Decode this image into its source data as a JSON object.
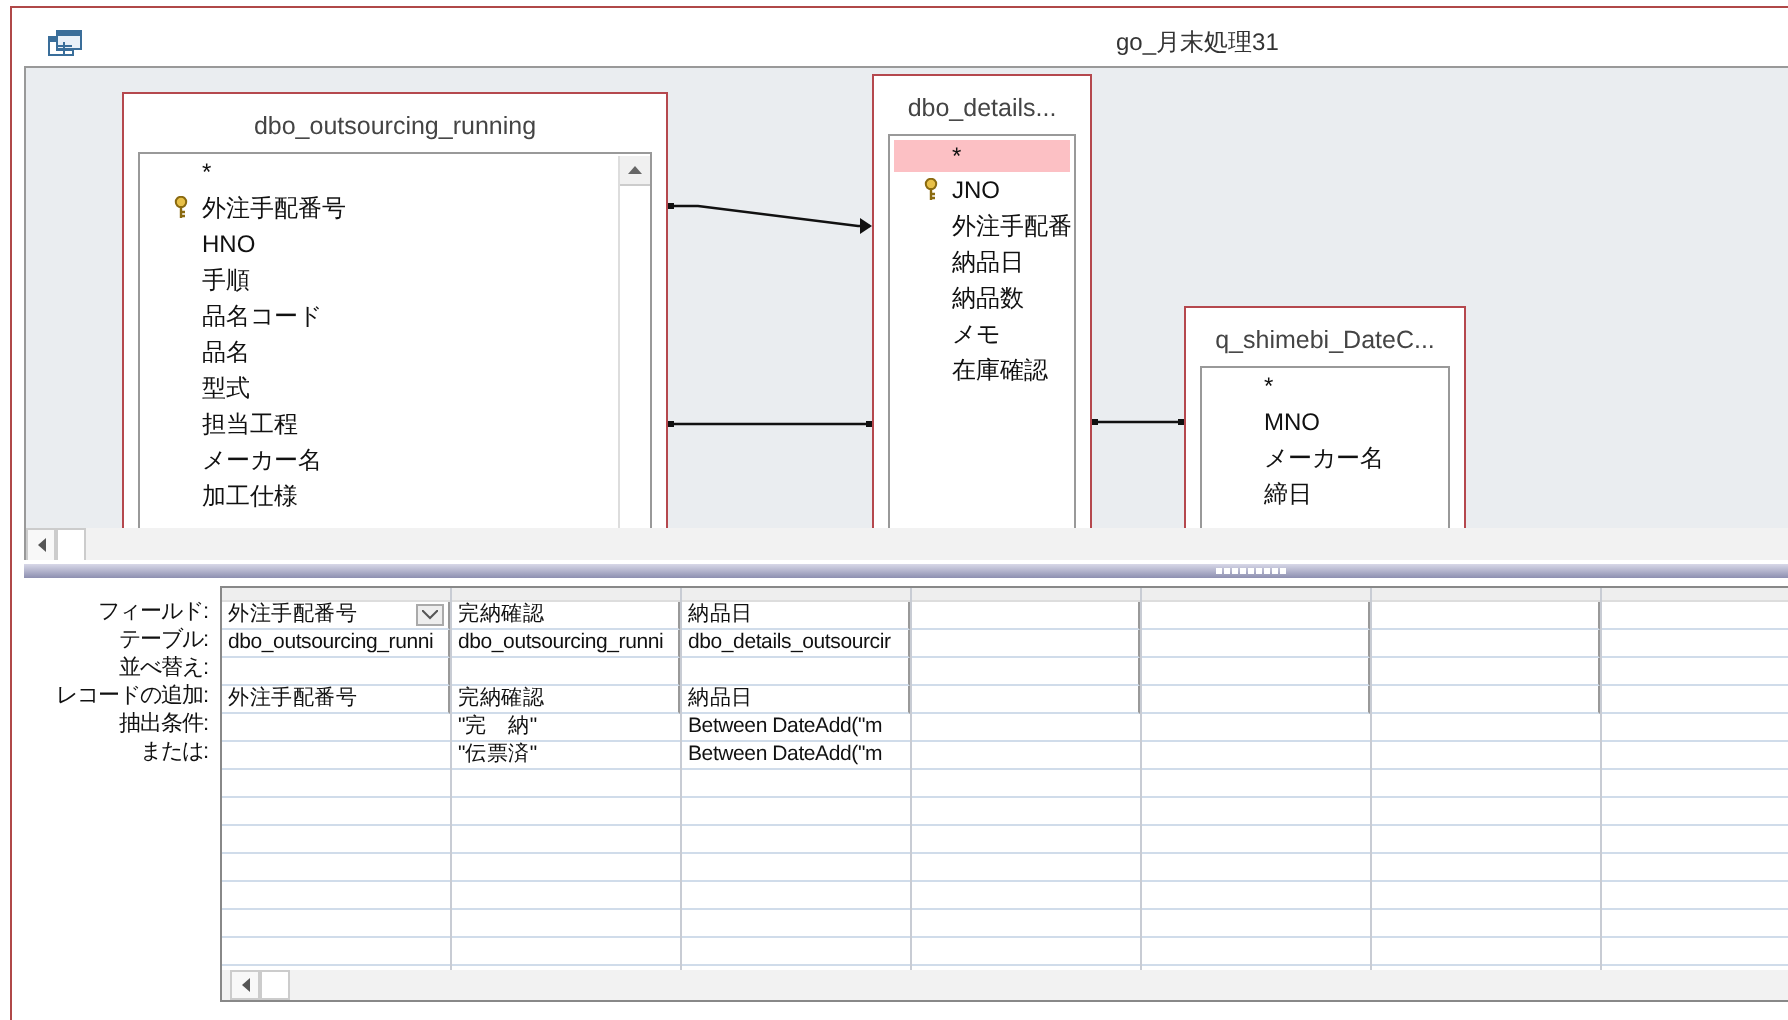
{
  "window": {
    "title": "go_月末処理31"
  },
  "tables": [
    {
      "title": "dbo_outsourcing_running",
      "scrollbar": true,
      "fields": [
        {
          "name": "*",
          "key": false,
          "selected": false
        },
        {
          "name": "外注手配番号",
          "key": true,
          "selected": false
        },
        {
          "name": "HNO",
          "key": false,
          "selected": false
        },
        {
          "name": "手順",
          "key": false,
          "selected": false
        },
        {
          "name": "品名コード",
          "key": false,
          "selected": false
        },
        {
          "name": "品名",
          "key": false,
          "selected": false
        },
        {
          "name": "型式",
          "key": false,
          "selected": false
        },
        {
          "name": "担当工程",
          "key": false,
          "selected": false
        },
        {
          "name": "メーカー名",
          "key": false,
          "selected": false
        },
        {
          "name": "加工仕様",
          "key": false,
          "selected": false
        }
      ]
    },
    {
      "title": "dbo_details...",
      "scrollbar": false,
      "fields": [
        {
          "name": "*",
          "key": false,
          "selected": true
        },
        {
          "name": "JNO",
          "key": true,
          "selected": false
        },
        {
          "name": "外注手配番",
          "key": false,
          "selected": false
        },
        {
          "name": "納品日",
          "key": false,
          "selected": false
        },
        {
          "name": "納品数",
          "key": false,
          "selected": false
        },
        {
          "name": "メモ",
          "key": false,
          "selected": false
        },
        {
          "name": "在庫確認",
          "key": false,
          "selected": false
        }
      ]
    },
    {
      "title": "q_shimebi_DateC...",
      "scrollbar": false,
      "fields": [
        {
          "name": "*",
          "key": false,
          "selected": false
        },
        {
          "name": "MNO",
          "key": false,
          "selected": false
        },
        {
          "name": "メーカー名",
          "key": false,
          "selected": false
        },
        {
          "name": "締日",
          "key": false,
          "selected": false
        }
      ]
    }
  ],
  "joins": [
    {
      "arrow": true
    },
    {
      "arrow": false
    },
    {
      "arrow": false
    }
  ],
  "grid": {
    "row_labels": [
      "フィールド:",
      "テーブル:",
      "並べ替え:",
      "レコードの追加:",
      "抽出条件:",
      "または:"
    ],
    "columns": [
      {
        "field": "外注手配番号",
        "dropdown": true,
        "table": "dbo_outsourcing_runni",
        "append": "外注手配番号"
      },
      {
        "field": "完納確認",
        "dropdown": false,
        "table": "dbo_outsourcing_runni",
        "append": "完納確認",
        "criteria": "\"完　納\"",
        "or": "\"伝票済\""
      },
      {
        "field": "納品日",
        "dropdown": false,
        "table": "dbo_details_outsourcir",
        "append": "納品日",
        "criteria": "Between DateAdd(\"m",
        "or": "Between DateAdd(\"m"
      }
    ]
  }
}
